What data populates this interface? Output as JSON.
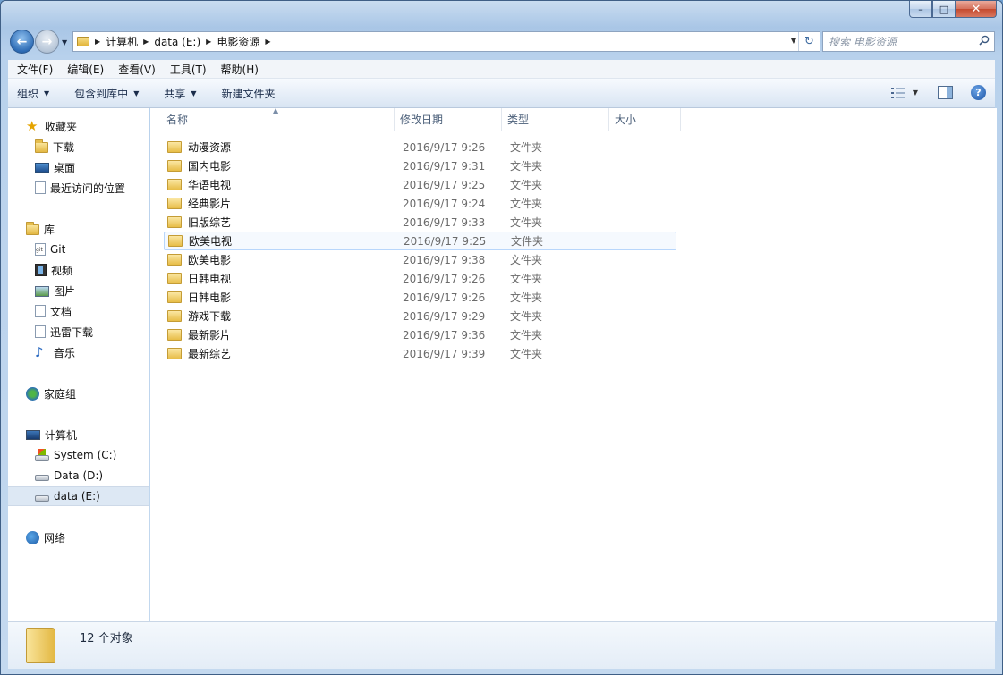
{
  "window": {
    "caption_buttons": {
      "minimize": "–",
      "maximize": "□",
      "close": "✕"
    }
  },
  "address_bar": {
    "crumbs": [
      "计算机",
      "data (E:)",
      "电影资源"
    ]
  },
  "search": {
    "placeholder": "搜索 电影资源"
  },
  "menu": [
    "文件(F)",
    "编辑(E)",
    "查看(V)",
    "工具(T)",
    "帮助(H)"
  ],
  "toolbar": {
    "organize": "组织",
    "include_library": "包含到库中",
    "share": "共享",
    "new_folder": "新建文件夹",
    "help": "?"
  },
  "nav": {
    "favorites": "收藏夹",
    "downloads": "下载",
    "desktop": "桌面",
    "recent": "最近访问的位置",
    "libraries": "库",
    "git": "Git",
    "videos": "视频",
    "pictures": "图片",
    "documents": "文档",
    "xunlei": "迅雷下载",
    "music": "音乐",
    "homegroup": "家庭组",
    "computer": "计算机",
    "drive_c": "System (C:)",
    "drive_d": "Data (D:)",
    "drive_e": "data (E:)",
    "network": "网络"
  },
  "columns": {
    "name": "名称",
    "modified": "修改日期",
    "type": "类型",
    "size": "大小"
  },
  "files": [
    {
      "name": "动漫资源",
      "modified": "2016/9/17 9:26",
      "type": "文件夹"
    },
    {
      "name": "国内电影",
      "modified": "2016/9/17 9:31",
      "type": "文件夹"
    },
    {
      "name": "华语电视",
      "modified": "2016/9/17 9:25",
      "type": "文件夹"
    },
    {
      "name": "经典影片",
      "modified": "2016/9/17 9:24",
      "type": "文件夹"
    },
    {
      "name": "旧版综艺",
      "modified": "2016/9/17 9:33",
      "type": "文件夹"
    },
    {
      "name": "欧美电视",
      "modified": "2016/9/17 9:25",
      "type": "文件夹"
    },
    {
      "name": "欧美电影",
      "modified": "2016/9/17 9:38",
      "type": "文件夹"
    },
    {
      "name": "日韩电视",
      "modified": "2016/9/17 9:26",
      "type": "文件夹"
    },
    {
      "name": "日韩电影",
      "modified": "2016/9/17 9:26",
      "type": "文件夹"
    },
    {
      "name": "游戏下载",
      "modified": "2016/9/17 9:29",
      "type": "文件夹"
    },
    {
      "name": "最新影片",
      "modified": "2016/9/17 9:36",
      "type": "文件夹"
    },
    {
      "name": "最新综艺",
      "modified": "2016/9/17 9:39",
      "type": "文件夹"
    }
  ],
  "details": {
    "count": "12 个对象"
  }
}
